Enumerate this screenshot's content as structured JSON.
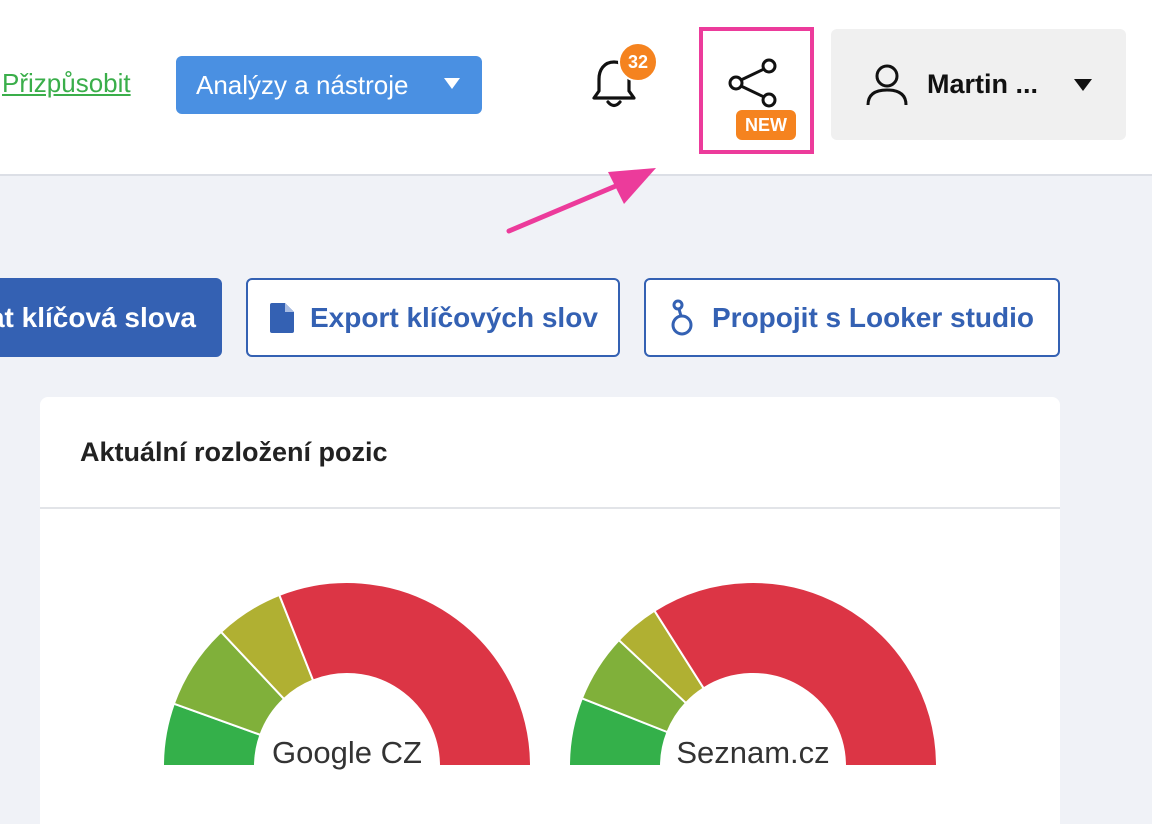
{
  "header": {
    "customize_link": "Přizpůsobit",
    "analyses_button": "Analýzy a nástroje",
    "notifications_count": "32",
    "share_new_badge": "NEW",
    "user_name": "Martin ..."
  },
  "toolbar": {
    "primary_button": "at klíčová slova",
    "export_button": "Export klíčových slov",
    "looker_button": "Propojit s Looker studio"
  },
  "card": {
    "title": "Aktuální rozložení pozic"
  },
  "gauges": [
    {
      "label": "Google CZ",
      "segments": [
        {
          "share": 0.11,
          "color": "#34b04a"
        },
        {
          "share": 0.15,
          "color": "#80b03a"
        },
        {
          "share": 0.12,
          "color": "#b0b032"
        },
        {
          "share": 0.62,
          "color": "#dc3545"
        }
      ]
    },
    {
      "label": "Seznam.cz",
      "segments": [
        {
          "share": 0.12,
          "color": "#34b04a"
        },
        {
          "share": 0.12,
          "color": "#80b03a"
        },
        {
          "share": 0.08,
          "color": "#b0b032"
        },
        {
          "share": 0.68,
          "color": "#dc3545"
        }
      ]
    }
  ],
  "colors": {
    "accent_blue": "#4a90e2",
    "primary_blue": "#3461b3",
    "link_green": "#3aae4a",
    "badge_orange": "#f5831f",
    "highlight_pink": "#ec3b9b"
  }
}
